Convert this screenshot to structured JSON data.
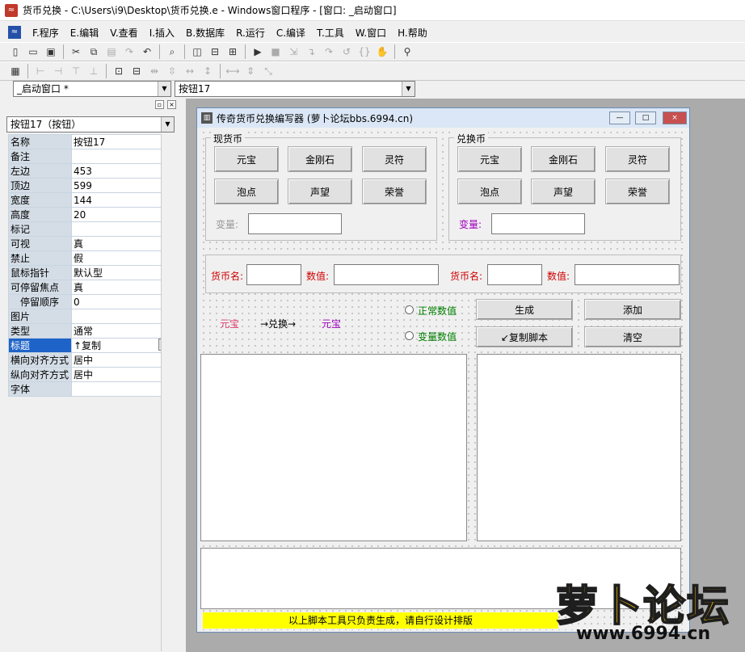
{
  "window": {
    "title": "货币兑换 - C:\\Users\\i9\\Desktop\\货币兑换.e - Windows窗口程序 - [窗口: _启动窗口]"
  },
  "menu": [
    "F.程序",
    "E.编辑",
    "V.查看",
    "I.插入",
    "B.数据库",
    "R.运行",
    "C.编译",
    "T.工具",
    "W.窗口",
    "H.帮助"
  ],
  "combos": {
    "window_select": "_启动窗口 *",
    "control_select": "按钮17"
  },
  "props": {
    "object": "按钮17（按钮）",
    "rows": [
      {
        "k": "名称",
        "v": "按钮17"
      },
      {
        "k": "备注",
        "v": ""
      },
      {
        "k": "左边",
        "v": "453"
      },
      {
        "k": "顶边",
        "v": "599"
      },
      {
        "k": "宽度",
        "v": "144"
      },
      {
        "k": "高度",
        "v": "20"
      },
      {
        "k": "标记",
        "v": ""
      },
      {
        "k": "可视",
        "v": "真"
      },
      {
        "k": "禁止",
        "v": "假"
      },
      {
        "k": "鼠标指针",
        "v": "默认型"
      },
      {
        "k": "可停留焦点",
        "v": "真"
      },
      {
        "k": "停留顺序",
        "v": "0"
      },
      {
        "k": "图片",
        "v": ""
      },
      {
        "k": "类型",
        "v": "通常"
      },
      {
        "k": "标题",
        "v": "↑复制"
      },
      {
        "k": "横向对齐方式",
        "v": "居中"
      },
      {
        "k": "纵向对齐方式",
        "v": "居中"
      },
      {
        "k": "字体",
        "v": ""
      }
    ],
    "ellipsis": "···"
  },
  "form": {
    "title": "传奇货币兑换编写器 (萝卜论坛bbs.6994.cn)",
    "left_group": {
      "legend": "现货币",
      "buttons": [
        "元宝",
        "金刚石",
        "灵符",
        "泡点",
        "声望",
        "荣誉"
      ],
      "var_label": "变量:"
    },
    "right_group": {
      "legend": "兑换币",
      "buttons": [
        "元宝",
        "金刚石",
        "灵符",
        "泡点",
        "声望",
        "荣誉"
      ],
      "var_label": "变量:"
    },
    "row2": {
      "name_label": "货币名:",
      "value_label": "数值:"
    },
    "preview": {
      "from": "元宝",
      "arrow": "→兑换→",
      "to": "元宝"
    },
    "radios": {
      "normal": "正常数值",
      "variable": "变量数值"
    },
    "actions": {
      "generate": "生成",
      "add": "添加",
      "copy_script": "↙复制脚本",
      "clear": "清空"
    },
    "footer": "以上脚本工具只负责生成，请自行设计排版"
  },
  "watermark": {
    "cn": "萝卜论坛",
    "en": "www.6994.cn"
  },
  "colors": {
    "red_label": "#d00000",
    "purple_label": "#a000c0",
    "green_label": "#008000",
    "yellow": "#ffff00",
    "selected_row": "#1e63c8"
  }
}
